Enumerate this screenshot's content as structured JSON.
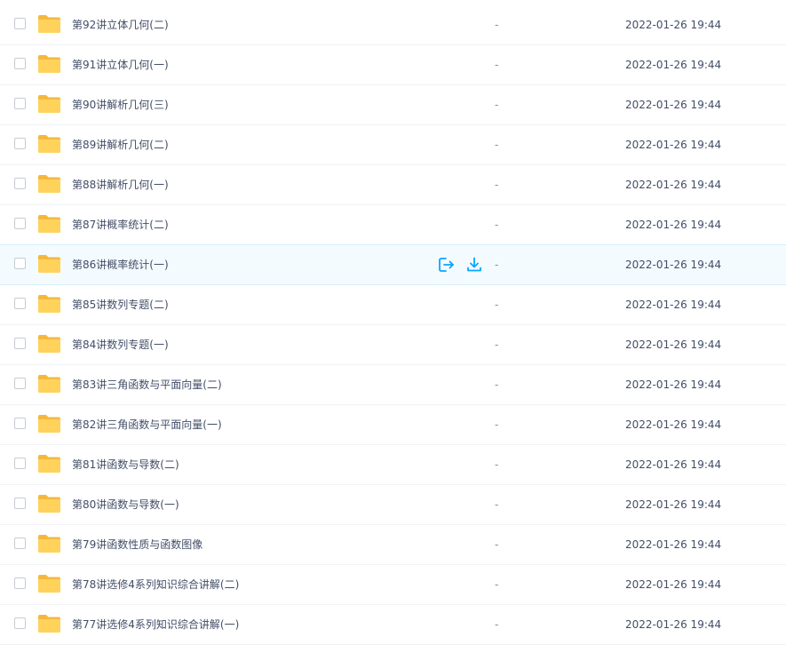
{
  "files": [
    {
      "name": "第92讲立体几何(二)",
      "size": "-",
      "date": "2022-01-26 19:44"
    },
    {
      "name": "第91讲立体几何(一)",
      "size": "-",
      "date": "2022-01-26 19:44"
    },
    {
      "name": "第90讲解析几何(三)",
      "size": "-",
      "date": "2022-01-26 19:44"
    },
    {
      "name": "第89讲解析几何(二)",
      "size": "-",
      "date": "2022-01-26 19:44"
    },
    {
      "name": "第88讲解析几何(一)",
      "size": "-",
      "date": "2022-01-26 19:44"
    },
    {
      "name": "第87讲概率统计(二)",
      "size": "-",
      "date": "2022-01-26 19:44"
    },
    {
      "name": "第86讲概率统计(一)",
      "size": "-",
      "date": "2022-01-26 19:44",
      "hovered": true
    },
    {
      "name": "第85讲数列专题(二)",
      "size": "-",
      "date": "2022-01-26 19:44"
    },
    {
      "name": "第84讲数列专题(一)",
      "size": "-",
      "date": "2022-01-26 19:44"
    },
    {
      "name": "第83讲三角函数与平面向量(二)",
      "size": "-",
      "date": "2022-01-26 19:44"
    },
    {
      "name": "第82讲三角函数与平面向量(一)",
      "size": "-",
      "date": "2022-01-26 19:44"
    },
    {
      "name": "第81讲函数与导数(二)",
      "size": "-",
      "date": "2022-01-26 19:44"
    },
    {
      "name": "第80讲函数与导数(一)",
      "size": "-",
      "date": "2022-01-26 19:44"
    },
    {
      "name": "第79讲函数性质与函数图像",
      "size": "-",
      "date": "2022-01-26 19:44"
    },
    {
      "name": "第78讲选修4系列知识综合讲解(二)",
      "size": "-",
      "date": "2022-01-26 19:44"
    },
    {
      "name": "第77讲选修4系列知识综合讲解(一)",
      "size": "-",
      "date": "2022-01-26 19:44"
    }
  ],
  "row_actions": {
    "share_icon": "share-export-icon",
    "download_icon": "download-icon"
  },
  "colors": {
    "folder": "#ffd25c",
    "folder_tab": "#f5b83d",
    "action": "#06a7ff",
    "hover_bg": "#f4fbff",
    "text": "#424e67"
  }
}
